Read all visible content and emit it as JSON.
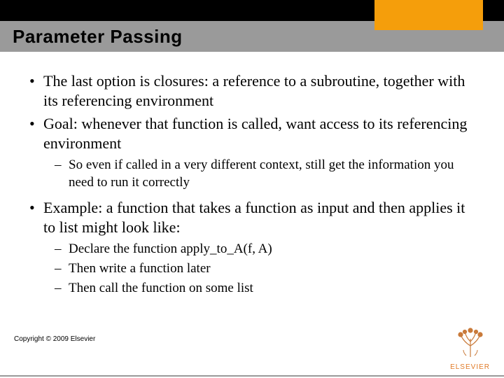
{
  "header": {
    "title": "Parameter Passing"
  },
  "bullets": {
    "b1": "The last option is closures: a reference to a subroutine, together with its referencing environment",
    "b2": "Goal: whenever that function is called, want access to its referencing environment",
    "b2_sub1": "So even if called in a very different context, still get the information you need to run it correctly",
    "b3": "Example: a function that takes a function as input and then applies it to list might look like:",
    "b3_sub1": "Declare the function apply_to_A(f, A)",
    "b3_sub2": "Then write a function later",
    "b3_sub3": "Then call the function on some list"
  },
  "footer": {
    "copyright": "Copyright © 2009 Elsevier",
    "publisher": "ELSEVIER"
  }
}
